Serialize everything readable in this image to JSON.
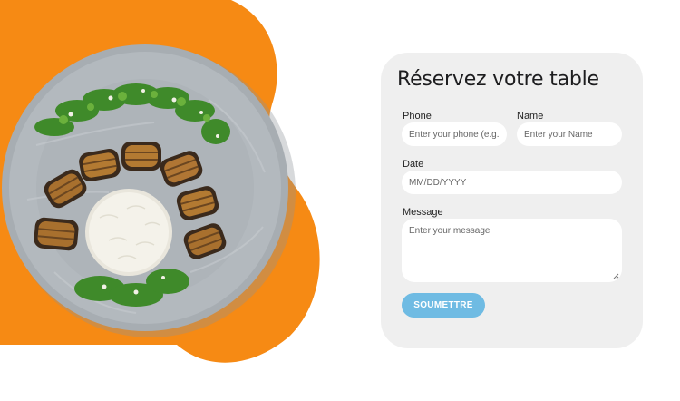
{
  "booking": {
    "title": "Réservez votre table",
    "fields": {
      "phone": {
        "label": "Phone",
        "placeholder": "Enter your phone (e.g."
      },
      "name": {
        "label": "Name",
        "placeholder": "Enter your Name"
      },
      "date": {
        "label": "Date",
        "placeholder": "MM/DD/YYYY"
      },
      "message": {
        "label": "Message",
        "placeholder": "Enter your message"
      }
    },
    "submit_label": "SOUMETTRE"
  },
  "colors": {
    "accent_orange": "#f68a14",
    "button_blue": "#6fbbe3",
    "card_background": "#efefef",
    "plate_gray": "#a7adb2"
  },
  "image": {
    "subject": "plate-of-eggplant-rolls-with-rice"
  }
}
